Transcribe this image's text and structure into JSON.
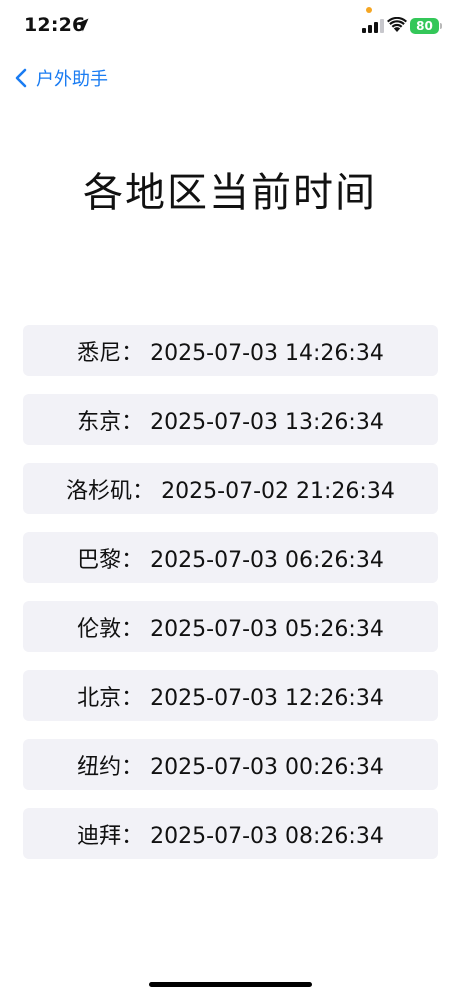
{
  "status_bar": {
    "time": "12:26",
    "battery": "80"
  },
  "nav": {
    "back_label": "户外助手"
  },
  "page": {
    "title": "各地区当前时间"
  },
  "times": [
    {
      "text": "悉尼：  2025-07-03 14:26:34"
    },
    {
      "text": "东京：  2025-07-03 13:26:34"
    },
    {
      "text": "洛杉矶：  2025-07-02 21:26:34"
    },
    {
      "text": "巴黎：  2025-07-03 06:26:34"
    },
    {
      "text": "伦敦：  2025-07-03 05:26:34"
    },
    {
      "text": "北京：  2025-07-03 12:26:34"
    },
    {
      "text": "纽约：  2025-07-03 00:26:34"
    },
    {
      "text": "迪拜：  2025-07-03 08:26:34"
    }
  ],
  "colors": {
    "accent": "#1a7cf2",
    "row_background": "#f2f2f7",
    "battery": "#34c759"
  },
  "icons": [
    "location-arrow-icon",
    "cellular-signal-icon",
    "wifi-icon",
    "battery-icon",
    "chevron-left-icon"
  ]
}
